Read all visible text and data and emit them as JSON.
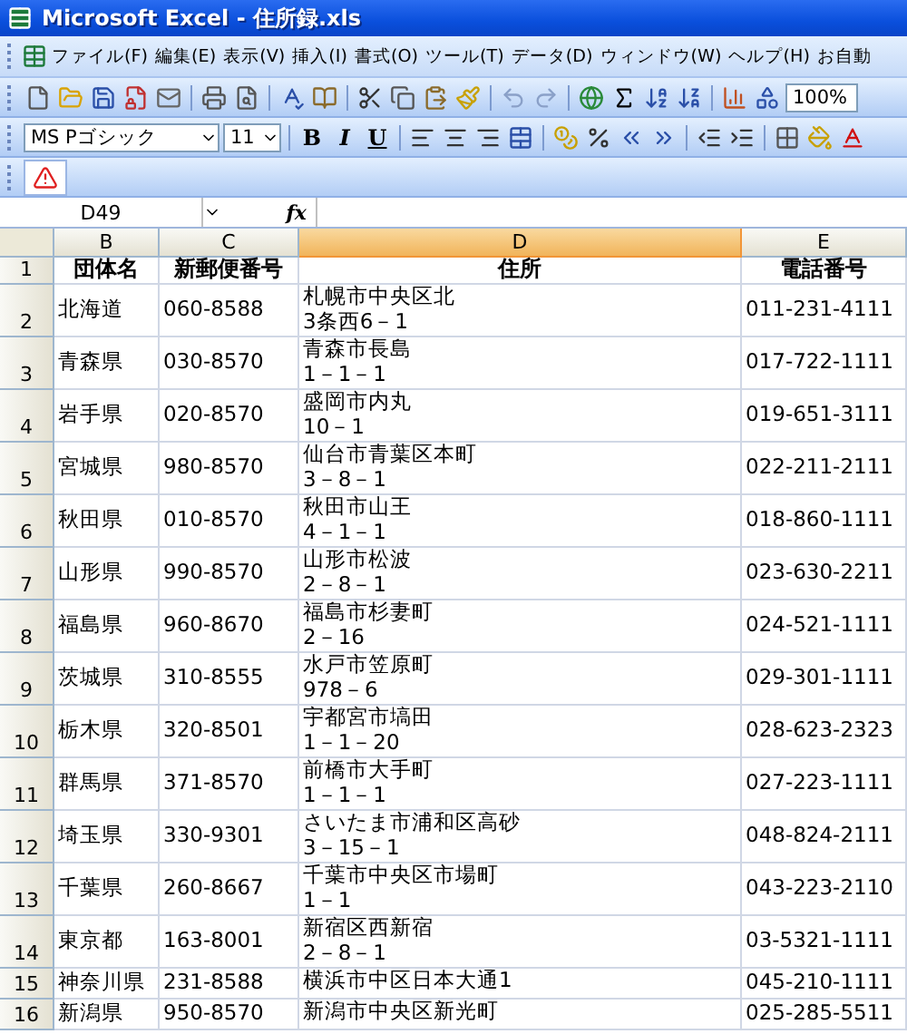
{
  "window": {
    "title": "Microsoft Excel - 住所録.xls"
  },
  "menu_bar": {
    "items": [
      "ファイル(F)",
      "編集(E)",
      "表示(V)",
      "挿入(I)",
      "書式(O)",
      "ツール(T)",
      "データ(D)",
      "ウィンドウ(W)",
      "ヘルプ(H)",
      "お自動"
    ]
  },
  "standard_toolbar": {
    "zoom": "100%"
  },
  "formatting_toolbar": {
    "font": "MS Pゴシック",
    "size": "11",
    "bold": "B",
    "italic": "I",
    "underline": "U"
  },
  "formula_bar": {
    "name_box": "D49",
    "function_label": "fx"
  },
  "sheet": {
    "columns": [
      {
        "label": "B",
        "selected": false
      },
      {
        "label": "C",
        "selected": false
      },
      {
        "label": "D",
        "selected": true
      },
      {
        "label": "E",
        "selected": false
      }
    ],
    "rows": [
      {
        "number": "1",
        "kind": "header",
        "name": "団体名",
        "postal": "新郵便番号",
        "address": [
          "住所"
        ],
        "phone": "電話番号"
      },
      {
        "number": "2",
        "kind": "data",
        "name": "北海道",
        "postal": "060-8588",
        "address": [
          "札幌市中央区北",
          "3条西6－1"
        ],
        "phone": "011-231-4111"
      },
      {
        "number": "3",
        "kind": "data",
        "name": "青森県",
        "postal": "030-8570",
        "address": [
          "青森市長島",
          "1－1－1"
        ],
        "phone": "017-722-1111"
      },
      {
        "number": "4",
        "kind": "data",
        "name": "岩手県",
        "postal": "020-8570",
        "address": [
          "盛岡市内丸",
          "10－1"
        ],
        "phone": "019-651-3111"
      },
      {
        "number": "5",
        "kind": "data",
        "name": "宮城県",
        "postal": "980-8570",
        "address": [
          "仙台市青葉区本町",
          "3－8－1"
        ],
        "phone": "022-211-2111"
      },
      {
        "number": "6",
        "kind": "data",
        "name": "秋田県",
        "postal": "010-8570",
        "address": [
          "秋田市山王",
          "4－1－1"
        ],
        "phone": "018-860-1111"
      },
      {
        "number": "7",
        "kind": "data",
        "name": "山形県",
        "postal": "990-8570",
        "address": [
          "山形市松波",
          "2－8－1"
        ],
        "phone": "023-630-2211"
      },
      {
        "number": "8",
        "kind": "data",
        "name": "福島県",
        "postal": "960-8670",
        "address": [
          "福島市杉妻町",
          "2－16"
        ],
        "phone": "024-521-1111"
      },
      {
        "number": "9",
        "kind": "data",
        "name": "茨城県",
        "postal": "310-8555",
        "address": [
          "水戸市笠原町",
          "978－6"
        ],
        "phone": "029-301-1111"
      },
      {
        "number": "10",
        "kind": "data",
        "name": "栃木県",
        "postal": "320-8501",
        "address": [
          "宇都宮市塙田",
          "1－1－20"
        ],
        "phone": "028-623-2323"
      },
      {
        "number": "11",
        "kind": "data",
        "name": "群馬県",
        "postal": "371-8570",
        "address": [
          "前橋市大手町",
          "1－1－1"
        ],
        "phone": "027-223-1111"
      },
      {
        "number": "12",
        "kind": "data",
        "name": "埼玉県",
        "postal": "330-9301",
        "address": [
          "さいたま市浦和区高砂",
          "3－15－1"
        ],
        "phone": "048-824-2111"
      },
      {
        "number": "13",
        "kind": "data",
        "name": "千葉県",
        "postal": "260-8667",
        "address": [
          "千葉市中央区市場町",
          "1－1"
        ],
        "phone": "043-223-2110"
      },
      {
        "number": "14",
        "kind": "data",
        "name": "東京都",
        "postal": "163-8001",
        "address": [
          "新宿区西新宿",
          "2－8－1"
        ],
        "phone": "03-5321-1111"
      },
      {
        "number": "15",
        "kind": "data",
        "name": "神奈川県",
        "postal": "231-8588",
        "address": [
          "横浜市中区日本大通1"
        ],
        "phone": "045-210-1111"
      },
      {
        "number": "16",
        "kind": "data",
        "name": "新潟県",
        "postal": "950-8570",
        "address": [
          "新潟市中央区新光町"
        ],
        "phone": "025-285-5511"
      }
    ]
  }
}
